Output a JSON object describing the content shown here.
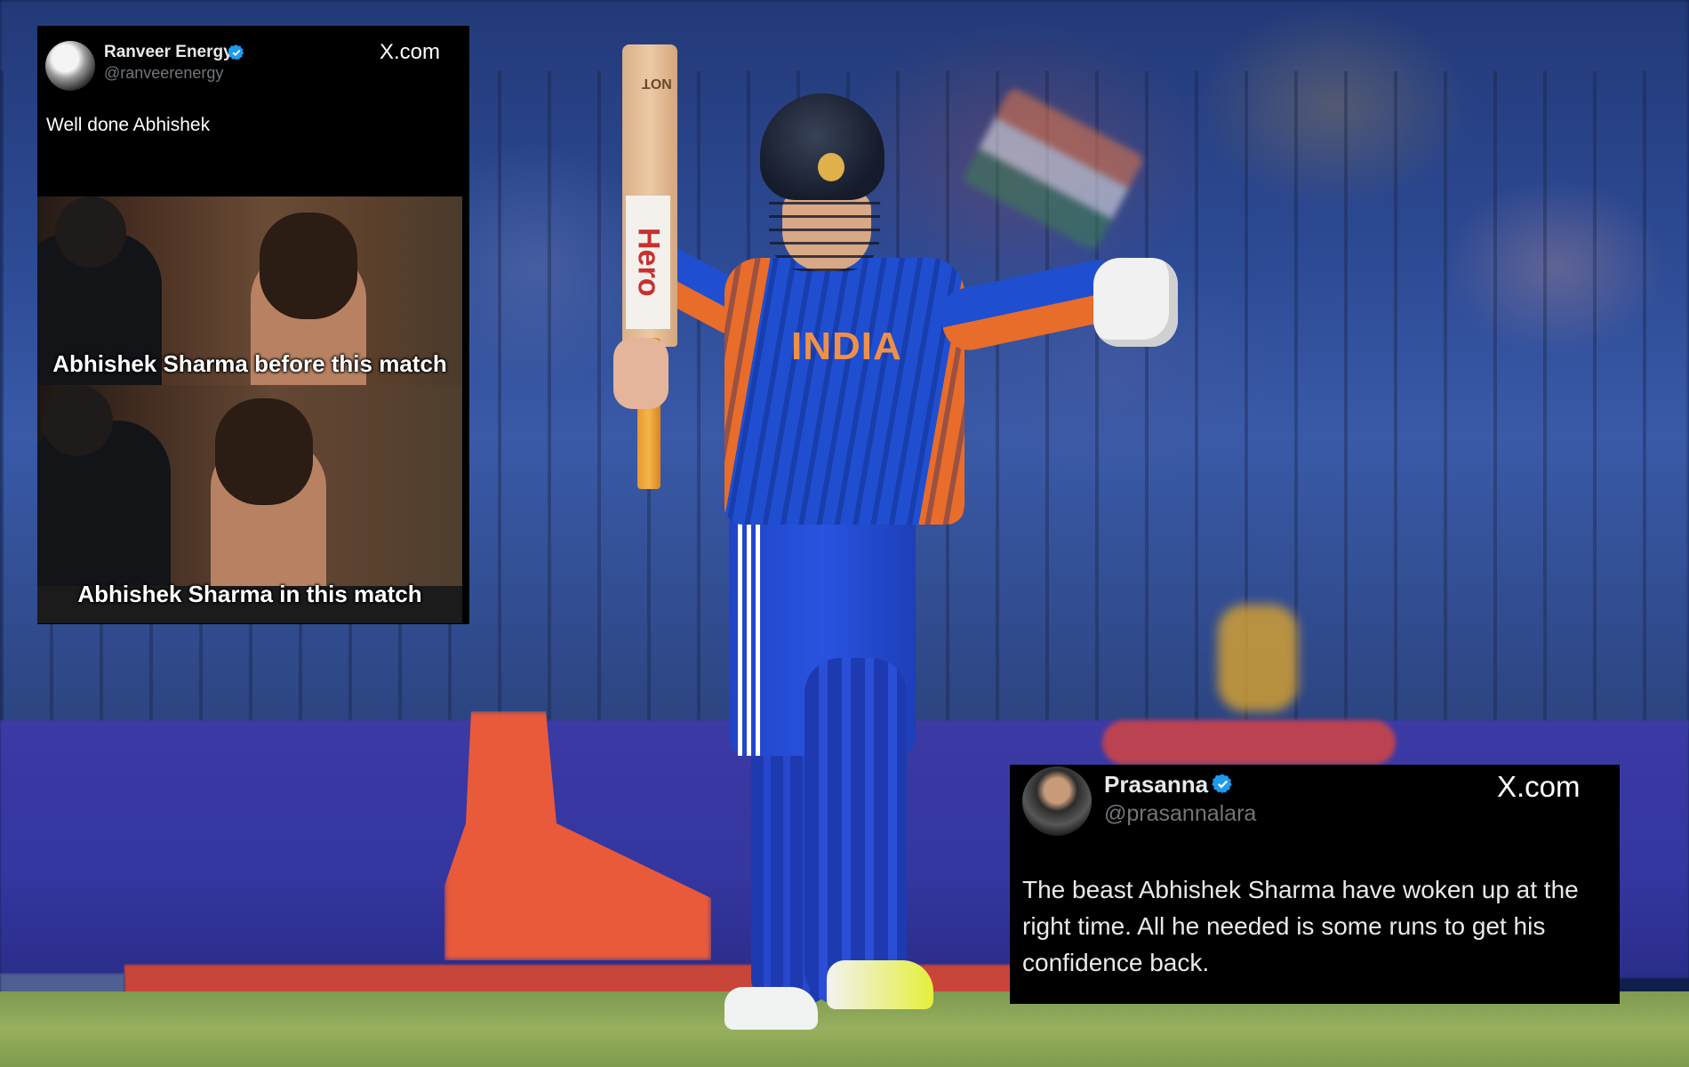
{
  "tweet_left": {
    "display_name": "Ranveer Energy",
    "handle": "@ranveerenergy",
    "source": "X.com",
    "text": "Well done Abhishek",
    "verified": true,
    "meme": {
      "top_caption": "Abhishek Sharma before this match",
      "bottom_caption": "Abhishek Sharma in this match"
    }
  },
  "tweet_right": {
    "display_name": "Prasanna",
    "handle": "@prasannalara",
    "source": "X.com",
    "text": "The beast Abhishek Sharma have woken up at the right time. All he needed is some runs to get his confidence back.",
    "verified": true
  },
  "photo": {
    "jersey_text": "INDIA",
    "bat_brand": "Hero",
    "bat_top": "NOT"
  },
  "colors": {
    "verified_blue": "#1d9bf0",
    "card_bg": "#000000",
    "jersey_blue": "#1f4fd0",
    "jersey_orange": "#e86c2a"
  }
}
